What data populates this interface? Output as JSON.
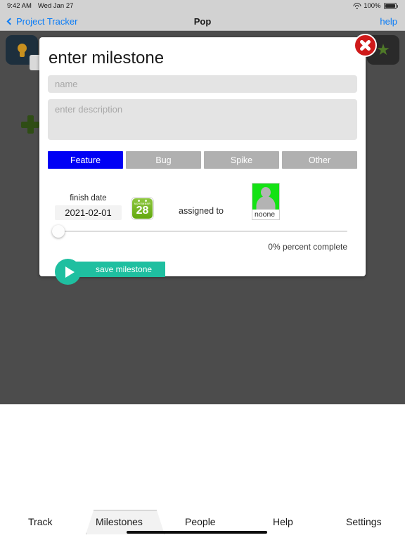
{
  "status_bar": {
    "time": "9:42 AM",
    "date": "Wed Jan 27",
    "battery_percent": "100%",
    "wifi_icon": "wifi-icon",
    "battery_icon": "battery-icon"
  },
  "nav_bar": {
    "back_label": "Project Tracker",
    "title": "Pop",
    "help_label": "help",
    "back_icon": "chevron-left-icon"
  },
  "background": {
    "bulb_icon": "lightbulb-icon",
    "star_icon": "star-icon",
    "plus_icon": "plus-icon"
  },
  "modal": {
    "title": "enter milestone",
    "close_icon": "close-icon",
    "name_input": {
      "value": "",
      "placeholder": "name"
    },
    "description_input": {
      "value": "",
      "placeholder": "enter description"
    },
    "segments": [
      {
        "label": "Feature",
        "selected": true
      },
      {
        "label": "Bug",
        "selected": false
      },
      {
        "label": "Spike",
        "selected": false
      },
      {
        "label": "Other",
        "selected": false
      }
    ],
    "selected_segment_color": "#0000f5",
    "unselected_segment_color": "#b0b0b0",
    "finish_date": {
      "label": "finish date",
      "value": "2021-02-01",
      "calendar_icon": "calendar-icon",
      "calendar_month": "NOVEMBER",
      "calendar_day": "28"
    },
    "assigned_to": {
      "label": "assigned to",
      "avatar_icon": "avatar",
      "name": "noone"
    },
    "progress": {
      "value": 0,
      "caption": "0% percent complete"
    },
    "save_button": {
      "label": "save milestone",
      "icon": "play-icon",
      "color": "#1fbfa0"
    }
  },
  "tab_bar": {
    "items": [
      {
        "label": "Track",
        "active": false
      },
      {
        "label": "Milestones",
        "active": true
      },
      {
        "label": "People",
        "active": false
      },
      {
        "label": "Help",
        "active": false
      },
      {
        "label": "Settings",
        "active": false
      }
    ]
  }
}
